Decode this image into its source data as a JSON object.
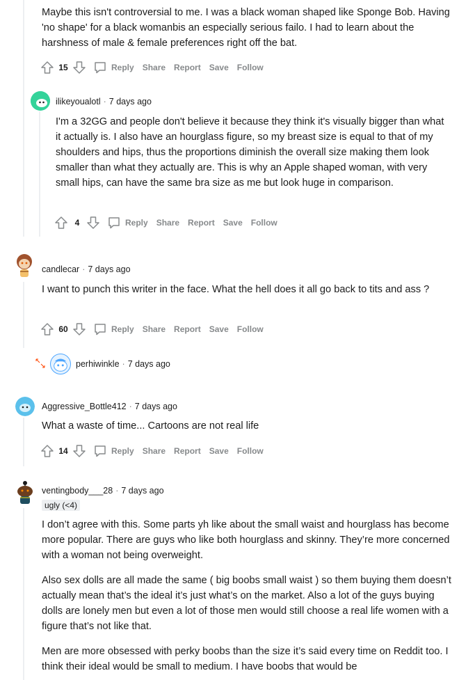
{
  "comments": [
    {
      "body": [
        "Maybe this isn't controversial to me. I was a black woman shaped like Sponge Bob. Having 'no shape' for a black womanbis an especially serious failo. I had to learn about the harshness of male & female preferences right off the bat."
      ],
      "score": "15"
    },
    {
      "author": "ilikeyoualotl",
      "time": "7 days ago",
      "body": [
        "I'm a 32GG and people don't believe it because they think it's visually bigger than what it actually is. I also have an hourglass figure, so my breast size is equal to that of my shoulders and hips, thus the proportions diminish the overall size making them look smaller than what they actually are. This is why an Apple shaped woman, with very small hips, can have the same bra size as me but look huge in comparison."
      ],
      "score": "4"
    },
    {
      "author": "candlecar",
      "time": "7 days ago",
      "body": [
        "I want to punch this writer in the face. What the hell does it all go back to tits and ass ?"
      ],
      "score": "60"
    },
    {
      "author": "perhiwinkle",
      "time": "7 days ago"
    },
    {
      "author": "Aggressive_Bottle412",
      "time": "7 days ago",
      "body": [
        "What a waste of time... Cartoons are not real life"
      ],
      "score": "14"
    },
    {
      "author": "ventingbody___28",
      "time": "7 days ago",
      "flair": "ugly (<4)",
      "body": [
        "I don’t agree with this. Some parts yh like about the small waist and hourglass has become more popular. There are guys who like both hourglass and skinny. They’re more concerned with a woman not being overweight.",
        "Also sex dolls are all made the same ( big boobs small waist ) so them buying them doesn’t actually mean that’s the ideal it’s just what’s on the market. Also a lot of the guys buying dolls are lonely men but even a lot of those men would still choose a real life women with a figure that’s not like that.",
        "Men are more obsessed with perky boobs than the size it’s said every time on Reddit too. I think their ideal would be small to medium. I have boobs that would be"
      ]
    }
  ],
  "actions": {
    "reply": "Reply",
    "share": "Share",
    "report": "Report",
    "save": "Save",
    "follow": "Follow"
  },
  "separator": "·",
  "icons": {
    "upvote": "upvote-arrow-icon",
    "downvote": "downvote-arrow-icon",
    "reply": "comment-bubble-icon",
    "expand": "expand-thread-icon"
  },
  "colors": {
    "action_gray": "#878a8c",
    "thread_line": "#edeff1",
    "expand_accent": "#ff4500"
  }
}
